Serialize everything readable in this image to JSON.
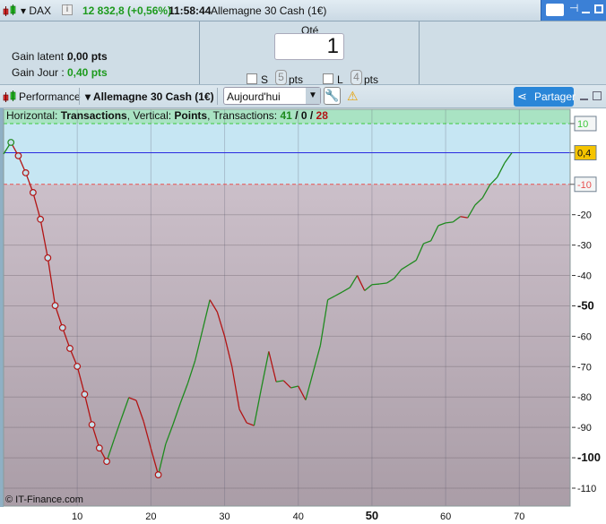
{
  "titlebar": {
    "symbol": "DAX",
    "price": "12 832,8 (+0,56%)",
    "time": "11:58:44",
    "instrument": "Allemagne 30 Cash (1€)",
    "info": "i"
  },
  "panel": {
    "gain_latent_label": "Gain latent :",
    "gain_latent_value": "0,00 pts",
    "gain_jour_label": "Gain Jour :",
    "gain_jour_value": "0,40 pts",
    "qty_label": "Qté",
    "qty_value": "1",
    "s_label": "S",
    "s_pts": "5",
    "l_label": "L",
    "l_pts": "4",
    "pts_label": "pts"
  },
  "toolbar": {
    "performance": "Performance",
    "instrument": "Allemagne 30 Cash (1€)",
    "period": "Aujourd'hui",
    "share": "Partager"
  },
  "chart_legend": {
    "h_label": "Horizontal: ",
    "h_value": "Transactions",
    "v_label": ", Vertical: ",
    "v_value": "Points",
    "t_label": ", Transactions: ",
    "wins": "41",
    "sep1": " / ",
    "neutral": "0",
    "sep2": " / ",
    "losses": "28"
  },
  "copyright": "© IT-Finance.com",
  "colors": {
    "up": "#1f8a1f",
    "down": "#b21414",
    "current": "#2a2ae0",
    "upper": "#3cc83c",
    "lower": "#e85050",
    "accent": "#2a86d8"
  },
  "chart_data": {
    "type": "line",
    "xlabel": "Transactions",
    "ylabel": "Points",
    "xlim": [
      0,
      76.9
    ],
    "ylim": [
      -115.9,
      14.7
    ],
    "x_ticks": [
      10,
      20,
      30,
      40,
      50,
      60,
      70
    ],
    "y_ticks": [
      -20,
      -30,
      -40,
      -50,
      -60,
      -70,
      -80,
      -90,
      -100,
      -110
    ],
    "upper_band": 10,
    "lower_band": -10,
    "current": 0.4,
    "upper_label": "10",
    "lower_label": "-10",
    "current_label": "0,4",
    "y": [
      0,
      3.8,
      -0.6,
      -6.2,
      -12.7,
      -21.5,
      -34.2,
      -49.9,
      -57.2,
      -64,
      -69.9,
      -79.1,
      -89.1,
      -96.8,
      -101.2,
      -94,
      -87,
      -80.2,
      -81.1,
      -88,
      -97,
      -105.6,
      -95.5,
      -89,
      -82,
      -75.5,
      -68,
      -58,
      -48,
      -52,
      -60,
      -70,
      -84,
      -88.5,
      -89.4,
      -77,
      -65,
      -75,
      -74.6,
      -77,
      -76.4,
      -81,
      -72,
      -63,
      -48,
      -46.7,
      -45.4,
      -44,
      -40,
      -45,
      -43,
      -42.8,
      -42.5,
      -41,
      -38,
      -36.5,
      -35,
      -29.5,
      -28.6,
      -23.6,
      -22.7,
      -22.4,
      -20.6,
      -21,
      -16.8,
      -14.5,
      -10.2,
      -7.7,
      -3,
      0.4
    ],
    "markers": [
      1,
      2,
      3,
      4,
      5,
      6,
      7,
      8,
      9,
      10,
      11,
      12,
      13,
      14,
      21
    ]
  }
}
